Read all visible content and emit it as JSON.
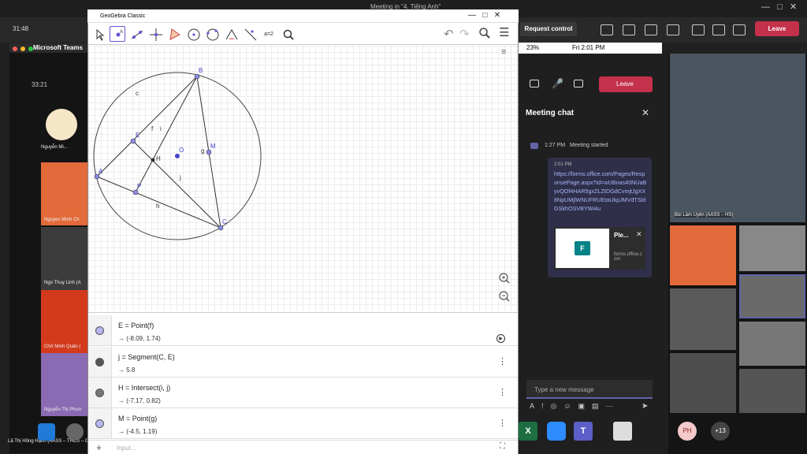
{
  "meeting_title": "Meeting in \"4. Tiếng Anh\"",
  "teams": {
    "clock": "31:48",
    "request_control": "Request control",
    "leave": "Leave"
  },
  "mac": {
    "app": "Microsoft Teams",
    "timer": "33:21",
    "participants": [
      "Nguyễn Mi...",
      "Nguyen Minh Ch",
      "Ngo Thuy Linh (A",
      "Chử Minh Quân (",
      "Nguyễn Thị Phươ"
    ],
    "bottom_name": "Lã Thị Hồng Hạnh (AASS – THCS – GV"
  },
  "geogebra": {
    "title": "GeoGebra Classic",
    "tools": [
      "move-tool",
      "point-tool",
      "line-tool",
      "perpendicular-tool",
      "polygon-tool",
      "circle-tool",
      "circle-3pts-tool",
      "angle-tool",
      "reflect-tool",
      "slider-tool",
      "zoom-tool"
    ],
    "slider_label": "a=2",
    "labels": {
      "B": "B",
      "c": "c",
      "E": "E",
      "f": "f",
      "i": "i",
      "O": "O",
      "g": "g",
      "M": "M",
      "A": "A",
      "H": "H",
      "j": "j",
      "P": "P",
      "h": "h",
      "C": "C"
    },
    "algebra": [
      {
        "def": "E = Point(f)",
        "val": "→  (-8.09, 1.74)",
        "color": "#b6b6f0",
        "action": "play"
      },
      {
        "def": "j = Segment(C, E)",
        "val": "→  5.8",
        "color": "#555555",
        "action": "menu"
      },
      {
        "def": "H = Intersect(i, j)",
        "val": "→  (-7.17, 0.82)",
        "color": "#555555",
        "action": "menu"
      },
      {
        "def": "M = Point(g)",
        "val": "→  (-4.5, 1.19)",
        "color": "#b6b6f0",
        "action": "menu"
      }
    ],
    "input_placeholder": "Input..."
  },
  "status": {
    "battery": "23%",
    "datetime": "Fri 2:01 PM"
  },
  "chat": {
    "leave": "Leave",
    "title": "Meeting chat",
    "started_time": "1:27 PM",
    "started_text": "Meeting started",
    "msg_time": "2:01 PM",
    "msg_link": "https://forms.office.com/Pages/ResponsePage.aspx?id=wUBnas40NUaByvQOf4HAR5gxZLZtDGdCvmjtJgXX8NpUMjlWNUFRUEtaUkpJMVdTSldGSkhOSVBYWi4u",
    "card_title": "Ple...",
    "card_domain": "forms.office.com",
    "compose_placeholder": "Type a new message"
  },
  "right": {
    "presenter": "Bùi Lâm Uyên (AASS – HS)",
    "more": "+13",
    "avatar": "PH"
  }
}
